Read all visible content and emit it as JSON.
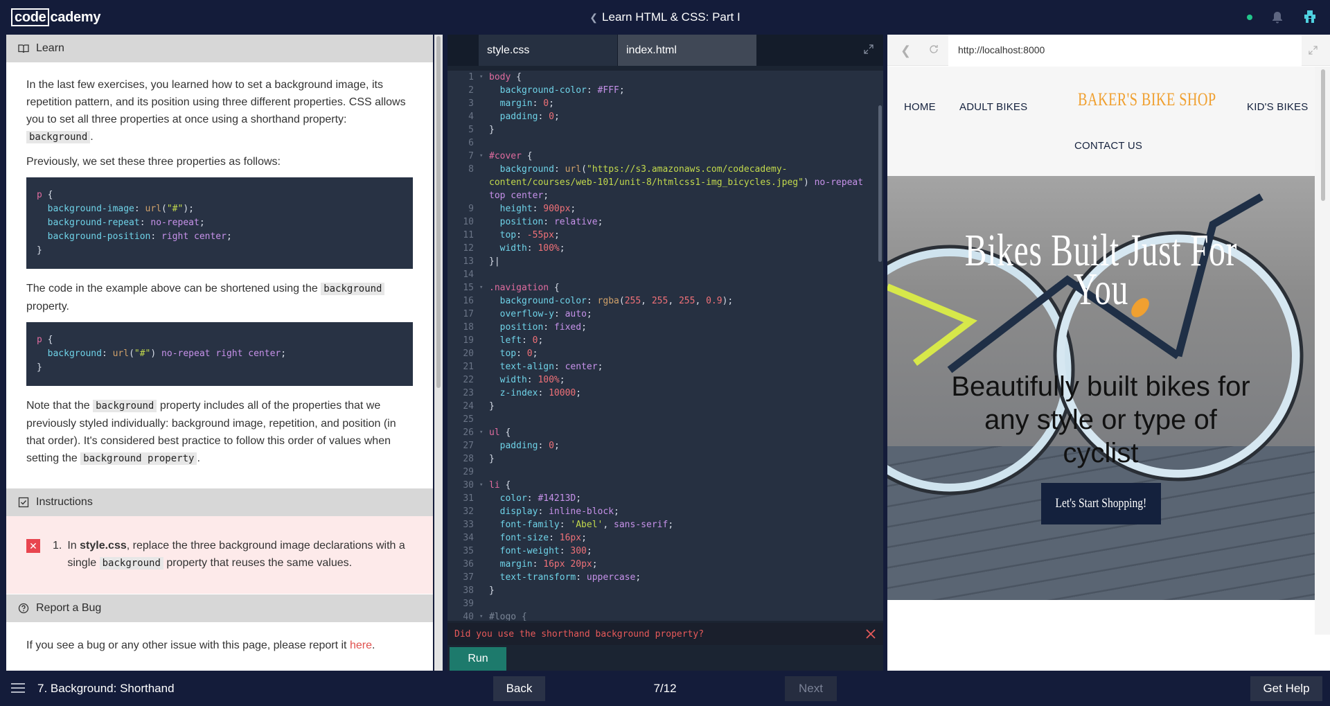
{
  "header": {
    "logo_box": "code",
    "logo_rest": "cademy",
    "course_title": "Learn HTML & CSS: Part I"
  },
  "learn": {
    "heading": "Learn",
    "p1": "In the last few exercises, you learned how to set a background image, its repetition pattern, and its position using three different properties. CSS allows you to set all three properties at once using a shorthand property:",
    "p1_code": "background",
    "p1_end": ".",
    "p2": "Previously, we set these three properties as follows:",
    "p3_before": "The code in the example above can be shortened using the",
    "p3_code": "background",
    "p3_after": "property.",
    "p4_before": "Note that the",
    "p4_code": "background",
    "p4_middle": "property includes all of the properties that we previously styled individually: background image, repetition, and position (in that order). It's considered best practice to follow this order of values when setting the",
    "p4_code2": "background property",
    "p4_end": "."
  },
  "instructions": {
    "heading": "Instructions",
    "number": "1.",
    "text_before": "In",
    "file": "style.css",
    "text_middle": ", replace the three background image declarations with a single",
    "code": "background",
    "text_after": "property that reuses the same values."
  },
  "bug": {
    "heading": "Report a Bug",
    "text": "If you see a bug or any other issue with this page, please report it",
    "link": "here",
    "end": "."
  },
  "editor": {
    "tabs": [
      "style.css",
      "index.html"
    ],
    "error_message": "Did you use the shorthand background property?",
    "run_label": "Run"
  },
  "preview": {
    "url": "http://localhost:8000",
    "nav": {
      "home": "HOME",
      "adult": "ADULT BIKES",
      "brand": "BAKER'S BIKE SHOP",
      "kids": "KID'S BIKES",
      "contact": "CONTACT US"
    },
    "hero_title": "Bikes Built Just For You",
    "hero_subtitle": "Beautifully built bikes for any style or type of cyclist",
    "shop_button": "Let's Start Shopping!"
  },
  "footer": {
    "lesson": "7. Background: Shorthand",
    "back": "Back",
    "progress": "7/12",
    "next": "Next",
    "help": "Get Help"
  },
  "colors": {
    "brand_dark": "#141c3a",
    "accent_green": "#1d7a6c",
    "error_red": "#e85a5a"
  }
}
